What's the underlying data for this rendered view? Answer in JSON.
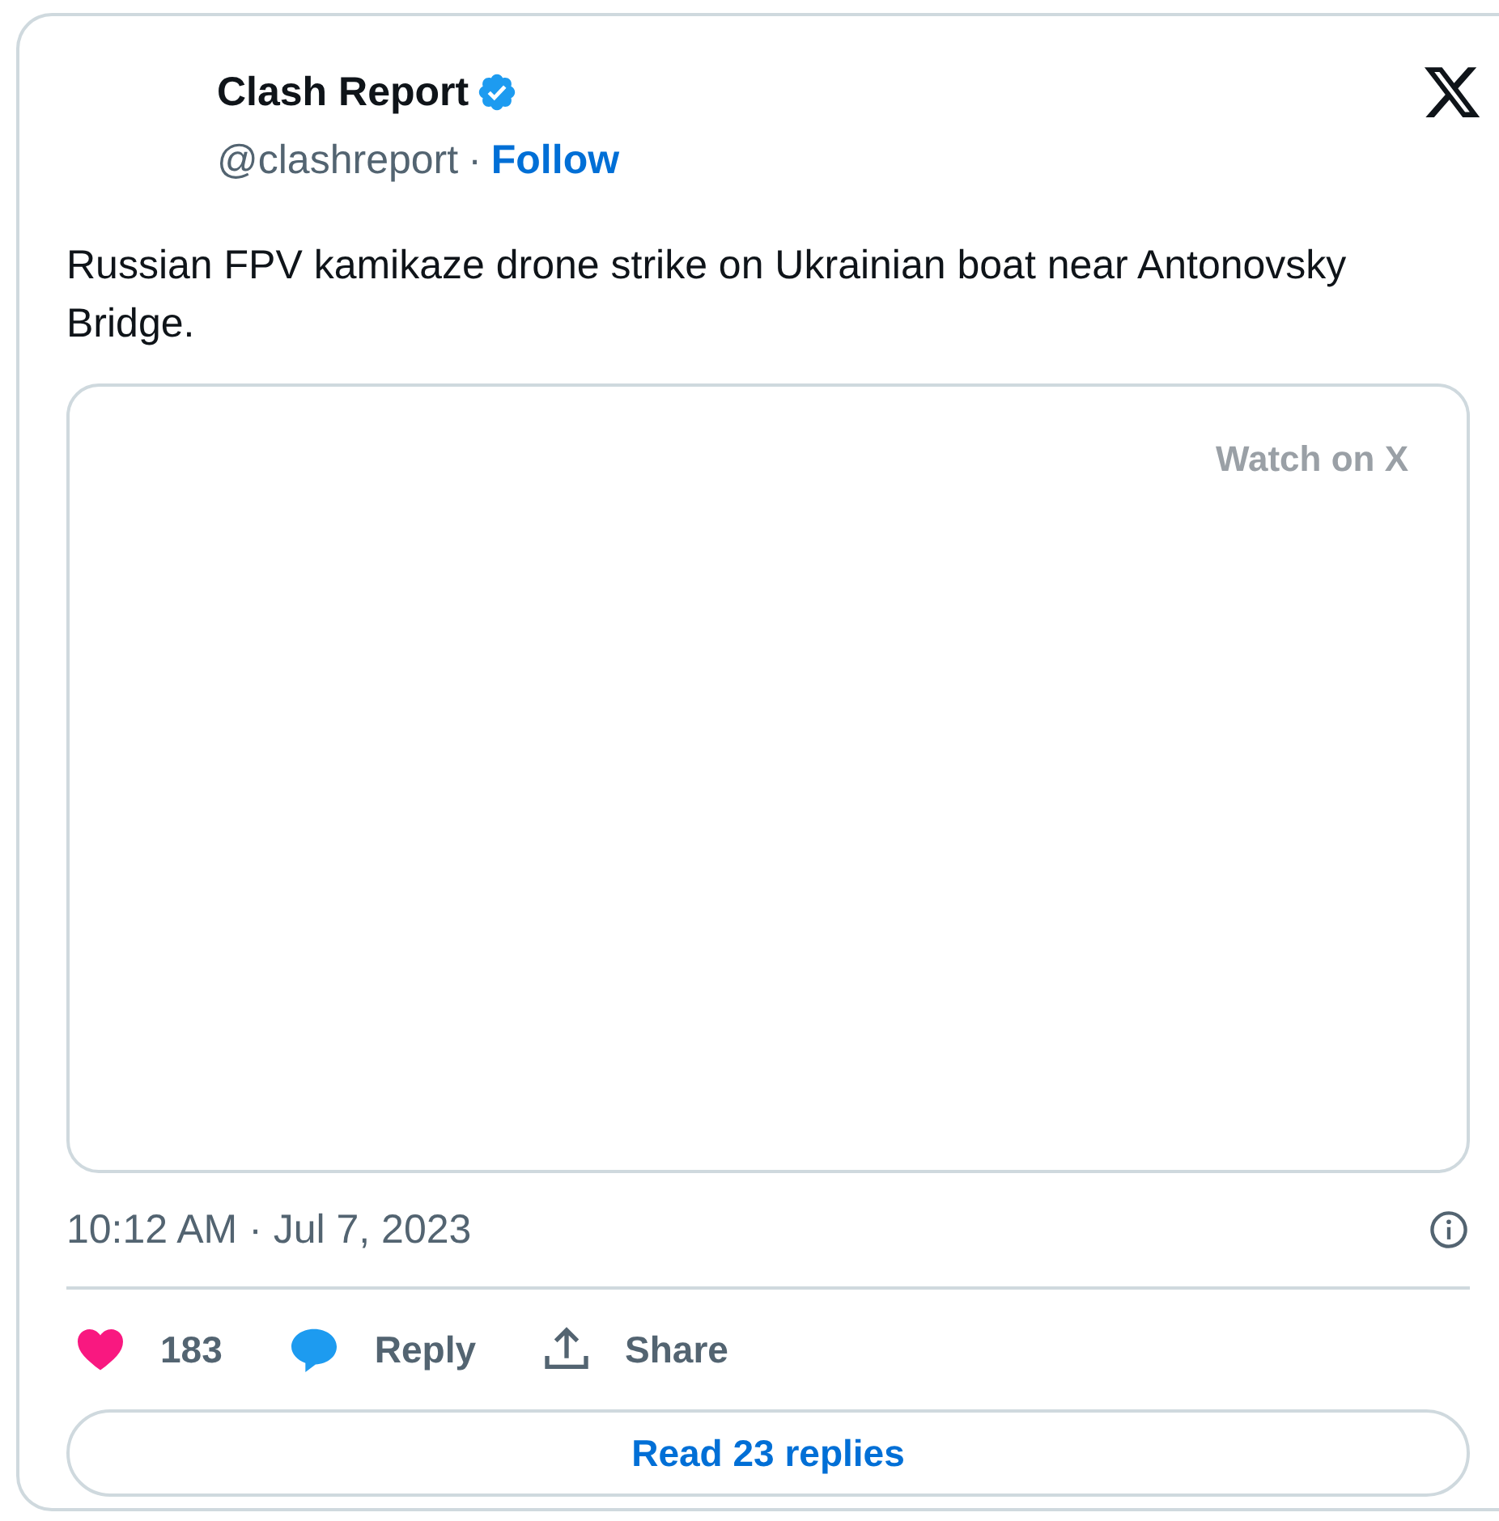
{
  "author": {
    "name": "Clash Report",
    "verified": true,
    "handle": "@clashreport",
    "separator": "·",
    "follow": "Follow"
  },
  "text": "Russian FPV kamikaze drone strike on Ukrainian boat near Antonovsky Bridge.",
  "media": {
    "watch_label": "Watch on X"
  },
  "timestamp": "10:12 AM · Jul 7, 2023",
  "actions": [
    {
      "kind": "like",
      "label": "183"
    },
    {
      "kind": "reply",
      "label": "Reply"
    },
    {
      "kind": "share",
      "label": "Share"
    }
  ],
  "read_replies": "Read 23 replies"
}
